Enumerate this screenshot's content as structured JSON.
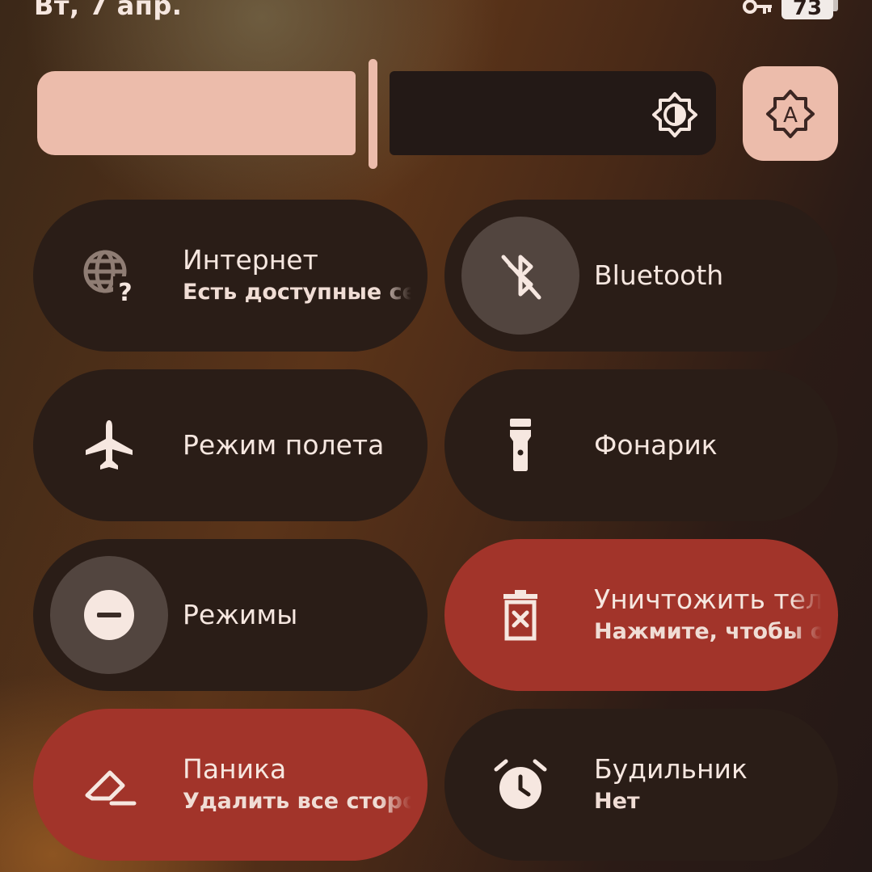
{
  "status_bar": {
    "date": "Вт, 7 апр.",
    "vpn_key_icon": "key-icon",
    "battery_level": "73"
  },
  "brightness": {
    "level_percent": 45,
    "icon": "brightness-medium-icon",
    "auto_icon": "brightness-auto-icon"
  },
  "colors": {
    "accent": "#ecbcab",
    "tile_inactive": "#2a1d17",
    "tile_active": "#a2342a",
    "icon_circle": "#52453f",
    "text": "#f6e7e0"
  },
  "tiles": [
    {
      "label": "Интернет",
      "subtitle": "Есть доступные сети",
      "icon": "globe-question-icon",
      "state": "inactive"
    },
    {
      "label": "Bluetooth",
      "subtitle": "",
      "icon": "bluetooth-off-icon",
      "state": "inactive"
    },
    {
      "label": "Режим полета",
      "subtitle": "",
      "icon": "airplane-icon",
      "state": "inactive"
    },
    {
      "label": "Фонарик",
      "subtitle": "",
      "icon": "flashlight-icon",
      "state": "inactive"
    },
    {
      "label": "Режимы",
      "subtitle": "",
      "icon": "do-not-disturb-icon",
      "state": "inactive"
    },
    {
      "label": "Уничтожить телефон",
      "subtitle": "Нажмите, чтобы очистить",
      "icon": "trash-x-icon",
      "state": "active"
    },
    {
      "label": "Паника",
      "subtitle": "Удалить все стороннее",
      "icon": "eraser-icon",
      "state": "active"
    },
    {
      "label": "Будильник",
      "subtitle": "Нет",
      "icon": "alarm-clock-icon",
      "state": "inactive"
    }
  ]
}
